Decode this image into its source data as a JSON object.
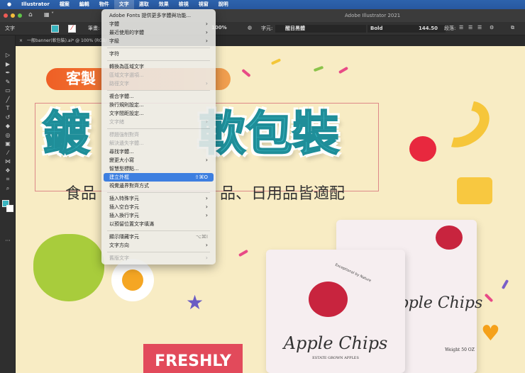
{
  "menubar": {
    "apple": "",
    "items": [
      "Illustrator",
      "檔案",
      "編輯",
      "物件",
      "文字",
      "選取",
      "效果",
      "檢視",
      "視窗",
      "說明"
    ],
    "active_index": 4
  },
  "titlebar": {
    "title": "Adobe Illustrator 2021"
  },
  "control": {
    "tool_label": "文字",
    "stroke_label": "筆畫:",
    "opacity": "100%",
    "char_label": "字元:",
    "font_name": "醒目黑體",
    "font_style": "Bold",
    "font_size": "144.50",
    "para_label": "段落:"
  },
  "tab": {
    "title": "一般banner(軟包裝).ai* @ 100% (RGB/"
  },
  "artwork": {
    "pill": "客製",
    "head_left": "鍍",
    "head_right": "軟包裝",
    "sub_left": "食品",
    "sub_right": "品、日用品皆適配",
    "bag_brand": "Apple Chips",
    "bag_tagline": "ESTATE GROWN APPLES",
    "bag_arc": "Exceptional by Nature",
    "bag_weight": "50 OZ",
    "bag_weight_label": "Weight"
  },
  "menu": {
    "items": [
      {
        "label": "Adobe Fonts 提供更多字體與功能...",
        "state": "normal"
      },
      {
        "label": "字體",
        "submenu": true
      },
      {
        "label": "最近使用的字體",
        "submenu": true
      },
      {
        "label": "字級",
        "submenu": true
      },
      {
        "sep": true
      },
      {
        "label": "字符"
      },
      {
        "sep": true
      },
      {
        "label": "轉換為區域文字"
      },
      {
        "label": "區域文字選項...",
        "disabled": true
      },
      {
        "label": "路徑文字",
        "submenu": true,
        "disabled": true
      },
      {
        "sep": true
      },
      {
        "label": "複合字體..."
      },
      {
        "label": "換行規則設定..."
      },
      {
        "label": "文字間距設定..."
      },
      {
        "label": "文字緒",
        "submenu": true,
        "disabled": true
      },
      {
        "sep": true
      },
      {
        "label": "標題強制對齊",
        "disabled": true
      },
      {
        "label": "解決遺失字體...",
        "disabled": true
      },
      {
        "label": "尋找字體..."
      },
      {
        "label": "變更大小寫",
        "submenu": true
      },
      {
        "label": "智慧型標點..."
      },
      {
        "label": "建立外框",
        "shortcut": "⇧⌘O",
        "highlighted": true
      },
      {
        "label": "視覺邊界對齊方式"
      },
      {
        "sep": true
      },
      {
        "label": "插入特殊字元",
        "submenu": true
      },
      {
        "label": "插入空白字元",
        "submenu": true
      },
      {
        "label": "插入換行字元",
        "submenu": true
      },
      {
        "label": "以預留位置文字填滿"
      },
      {
        "sep": true
      },
      {
        "label": "顯示隱藏字元",
        "shortcut": "⌥⌘I"
      },
      {
        "label": "文字方向",
        "submenu": true
      },
      {
        "sep": true
      },
      {
        "label": "舊版文字",
        "submenu": true,
        "disabled": true
      }
    ]
  },
  "tools": [
    "selection",
    "direct-selection",
    "pen",
    "curvature",
    "rectangle",
    "paintbrush",
    "type",
    "rotate",
    "eraser",
    "warp",
    "gradient",
    "eyedropper",
    "blend",
    "symbol-sprayer",
    "artboard",
    "zoom"
  ],
  "colors": {
    "fill": "#3ab5c0",
    "menubar": "#2d63ad",
    "highlight": "#3d7fe0"
  }
}
